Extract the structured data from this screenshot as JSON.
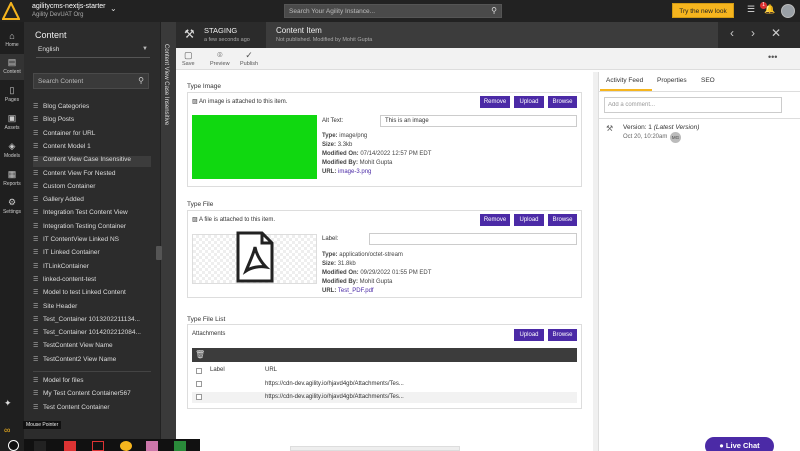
{
  "topbar": {
    "app_name": "agilitycms-nextjs-starter",
    "org_name": "Agility DevUAT Org",
    "search_placeholder": "Search Your Agility Instance...",
    "try_button": "Try the new look",
    "notification_count": "1",
    "colors": {
      "bar": "#222222",
      "accent": "#f6b51e"
    }
  },
  "leftnav": [
    {
      "label": "Home",
      "icon": "home-icon"
    },
    {
      "label": "Content",
      "icon": "content-icon",
      "active": true
    },
    {
      "label": "Pages",
      "icon": "pages-icon"
    },
    {
      "label": "Assets",
      "icon": "assets-icon"
    },
    {
      "label": "Models",
      "icon": "models-icon"
    },
    {
      "label": "Reports",
      "icon": "reports-icon"
    },
    {
      "label": "Settings",
      "icon": "settings-icon"
    }
  ],
  "content_panel": {
    "title": "Content",
    "language": "English",
    "search_placeholder": "Search Content",
    "items": [
      "Blog Categories",
      "Blog Posts",
      "Container for URL",
      "Content Model 1",
      "Content View Case Insensitive",
      "Content View For Nested",
      "Custom Container",
      "Gallery Added",
      "Integration Test Content View",
      "Integration Testing Container",
      "IT ContentView Linked NS",
      "IT Linked Container",
      "ITLinkContainer",
      "linked-content-test",
      "Model to test Linked Content",
      "Site Header",
      "Test_Container 1013202211134...",
      "Test_Container 1014202212084...",
      "TestContent View Name",
      "TestContent2 View Name"
    ],
    "items2": [
      "Model for files",
      "My Test Content Container567",
      "Test Content Container"
    ],
    "active_item": "Content View Case Insensitive",
    "tooltip": "Mouse Pointer"
  },
  "vstrip_label": "Content View Case Insensitive",
  "stage": {
    "name": "STAGING",
    "time": "a few seconds ago"
  },
  "content_item": {
    "title": "Content Item",
    "subtitle": "Not published. Modified by Mohit Gupta"
  },
  "toolbar": {
    "save": "Save",
    "preview": "Preview",
    "publish": "Publish"
  },
  "image_field": {
    "title": "Type Image",
    "note": "An image is attached to this item.",
    "remove": "Remove",
    "upload": "Upload",
    "browse": "Browse",
    "alt_label": "Alt Text:",
    "alt_value": "This is an image",
    "type_label": "Type:",
    "type_value": "image/png",
    "size_label": "Size:",
    "size_value": "3.3kb",
    "modified_on_label": "Modified On:",
    "modified_on_value": "07/14/2022 12:57 PM EDT",
    "modified_by_label": "Modified By:",
    "modified_by_value": "Mohit Gupta",
    "url_label": "URL:",
    "url_value": "image-3.png",
    "image_color": "#10d810"
  },
  "file_field": {
    "title": "Type File",
    "note": "A file is attached to this item.",
    "remove": "Remove",
    "upload": "Upload",
    "browse": "Browse",
    "label_label": "Label:",
    "label_value": "",
    "type_label": "Type:",
    "type_value": "application/octet-stream",
    "size_label": "Size:",
    "size_value": "31.8kb",
    "modified_on_label": "Modified On:",
    "modified_on_value": "09/29/2022 01:55 PM EDT",
    "modified_by_label": "Modified By:",
    "modified_by_value": "Mohit Gupta",
    "url_label": "URL:",
    "url_value": "Test_PDF.pdf"
  },
  "file_list": {
    "title": "Type File List",
    "attachments_label": "Attachments",
    "upload": "Upload",
    "browse": "Browse",
    "columns": [
      "Label",
      "URL"
    ],
    "rows": [
      {
        "label": "",
        "url": "https://cdn-dev.agility.io/hjavd4gb/Attachments/Tes..."
      },
      {
        "label": "",
        "url": "https://cdn-dev.agility.io/hjavd4gb/Attachments/Tes..."
      }
    ]
  },
  "right_panel": {
    "tabs": [
      "Activity Feed",
      "Properties",
      "SEO"
    ],
    "active_tab": "Activity Feed",
    "comment_placeholder": "Add a comment...",
    "version": "Version: 1",
    "version_tag": "(Latest Version)",
    "version_date": "Oct 20, 10:20am",
    "version_initials": "MG"
  },
  "live_chat": "Live Chat",
  "button_color": "#4b2aa6"
}
